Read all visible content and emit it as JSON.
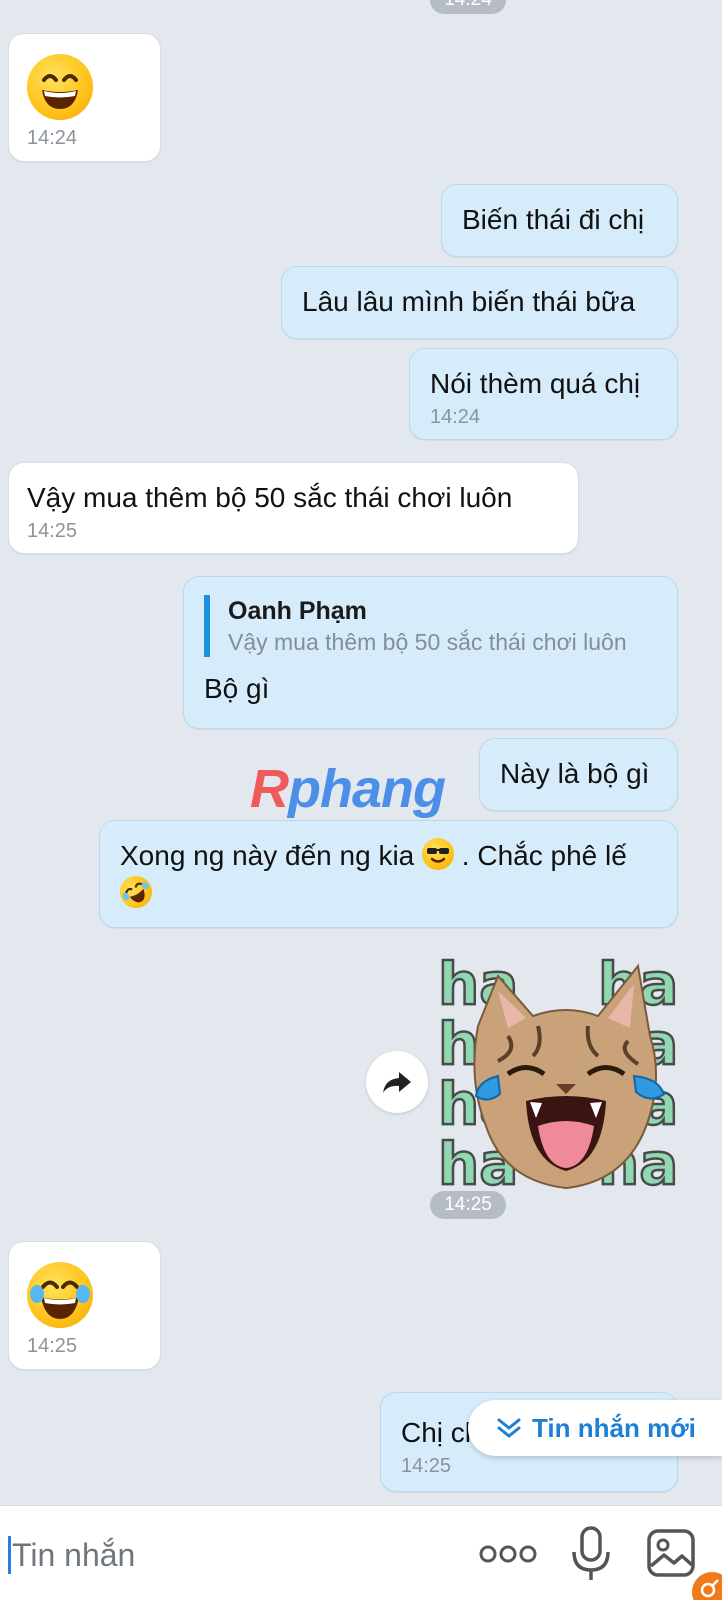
{
  "messages": {
    "top_timestamp": "14:24",
    "m1": {
      "time": "14:24"
    },
    "m2": {
      "text": "Biến thái đi chị"
    },
    "m3": {
      "text": "Lâu lâu mình biến thái bữa"
    },
    "m4": {
      "text": "Nói thèm quá chị",
      "time": "14:24"
    },
    "m5": {
      "text": "Vậy mua thêm bộ 50 sắc thái chơi luôn",
      "time": "14:25"
    },
    "m6": {
      "quote_name": "Oanh Phạm",
      "quote_text": "Vậy mua thêm bộ 50 sắc thái chơi luôn",
      "text": "Bộ gì"
    },
    "m7": {
      "text": "Này là bộ gì"
    },
    "m8": {
      "text_a": "Xong ng này đến ng kia",
      "text_b": ". Chắc phê lế"
    },
    "sticker_words": [
      "ha",
      "ha",
      "ha",
      "ha"
    ],
    "sticker_time": "14:25",
    "m9": {
      "time": "14:25"
    },
    "m10": {
      "text": "Chị chỉ nằm mà ư a",
      "time": "14:25"
    }
  },
  "watermark": {
    "part1": "R",
    "part2": "phang"
  },
  "new_message_label": "Tin nhắn mới",
  "input": {
    "placeholder": "Tin nhắn"
  },
  "icons": {
    "emoji_grin": "grinning-face",
    "emoji_laugh_tears": "face-with-tears-of-joy",
    "emoji_sunglasses": "smiling-face-with-sunglasses",
    "emoji_rolling_laugh": "rolling-on-floor-laughing",
    "forward": "forward-arrow",
    "more": "more-dots",
    "mic": "microphone",
    "gallery": "image"
  },
  "colors": {
    "accent": "#1d7fd6",
    "outgoing_bubble": "#d6ecfb",
    "incoming_bubble": "#ffffff",
    "background": "#e2e8ee"
  }
}
